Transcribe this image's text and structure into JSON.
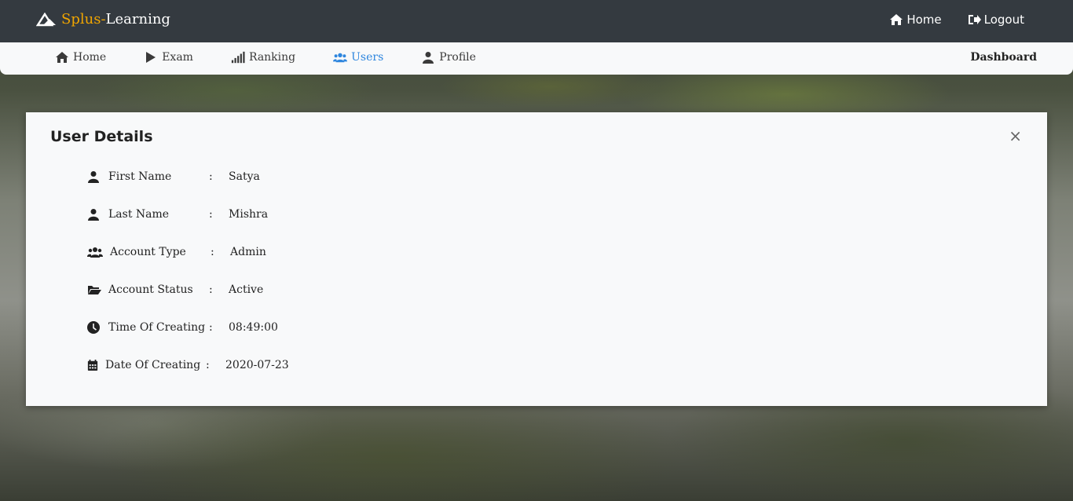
{
  "brand": {
    "name_part1": "Splus-",
    "name_part2": "Learning",
    "accent_color": "#f0a500"
  },
  "topbar": {
    "links": [
      {
        "label": "Home",
        "icon": "home-icon"
      },
      {
        "label": "Logout",
        "icon": "logout-icon"
      }
    ],
    "background": "#343a40"
  },
  "subnav": {
    "items": [
      {
        "label": "Home",
        "icon": "home-icon"
      },
      {
        "label": "Exam",
        "icon": "play-icon"
      },
      {
        "label": "Ranking",
        "icon": "signal-bars-icon"
      },
      {
        "label": "Users",
        "icon": "users-icon",
        "active": true
      },
      {
        "label": "Profile",
        "icon": "user-icon"
      }
    ],
    "right_label": "Dashboard",
    "active_color": "#2e86de"
  },
  "card": {
    "title": "User Details",
    "close": "×",
    "details": [
      {
        "label": "First Name",
        "sep": ":",
        "value": "Satya",
        "icon": "user-icon"
      },
      {
        "label": "Last Name",
        "sep": ":",
        "value": "Mishra",
        "icon": "user-icon"
      },
      {
        "label": "Account Type",
        "sep": ":",
        "value": "Admin",
        "icon": "users-icon"
      },
      {
        "label": "Account Status",
        "sep": ":",
        "value": "Active",
        "icon": "folder-open-icon"
      },
      {
        "label": "Time Of Creating",
        "sep": ":",
        "value": "08:49:00",
        "icon": "clock-icon"
      },
      {
        "label": "Date Of Creating",
        "sep": ":",
        "value": "2020-07-23",
        "icon": "calendar-icon"
      }
    ]
  }
}
